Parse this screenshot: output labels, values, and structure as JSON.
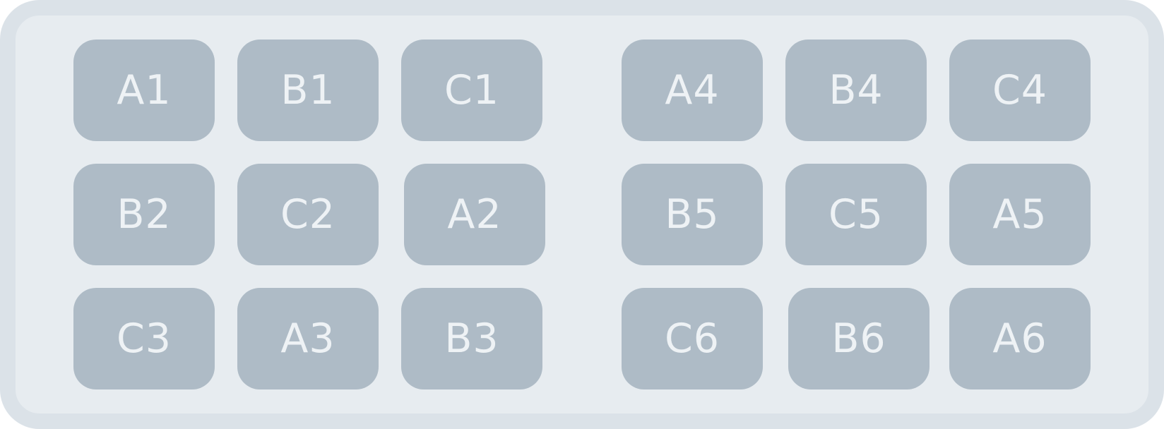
{
  "group_left": {
    "rows": [
      [
        "A1",
        "B1",
        "C1"
      ],
      [
        "B2",
        "C2",
        "A2"
      ],
      [
        "C3",
        "A3",
        "B3"
      ]
    ]
  },
  "group_right": {
    "rows": [
      [
        "A4",
        "B4",
        "C4"
      ],
      [
        "B5",
        "C5",
        "A5"
      ],
      [
        "C6",
        "B6",
        "A6"
      ]
    ]
  },
  "colors": {
    "frame": "#dbe2e8",
    "background": "#e7ecf0",
    "tile": "#aebbc6",
    "tile_text": "#eef2f5"
  }
}
